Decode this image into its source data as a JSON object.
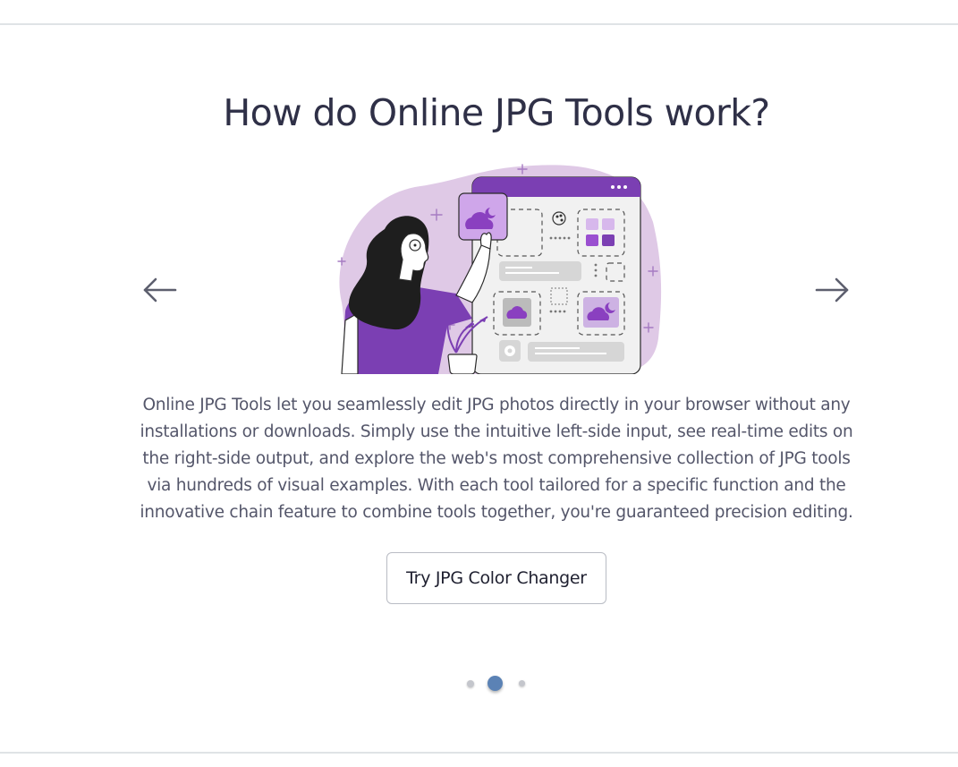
{
  "section": {
    "title": "How do Online JPG Tools work?",
    "description": "Online JPG Tools let you seamlessly edit JPG photos directly in your browser without any installations or downloads. Simply use the intuitive left-side input, see real-time edits on the right-side output, and explore the web's most comprehensive collection of JPG tools via hundreds of visual examples. With each tool tailored for a specific function and the innovative chain feature to combine tools together, you're guaranteed precision editing.",
    "cta_label": "Try JPG Color Changer"
  },
  "carousel": {
    "prev_icon": "arrow-left-icon",
    "next_icon": "arrow-right-icon",
    "slide_count": 3,
    "active_slide": 2
  },
  "colors": {
    "accent_purple": "#7b3fb3",
    "active_dot": "#5b82b5",
    "title_text": "#2f3047",
    "body_text": "#54566a"
  }
}
